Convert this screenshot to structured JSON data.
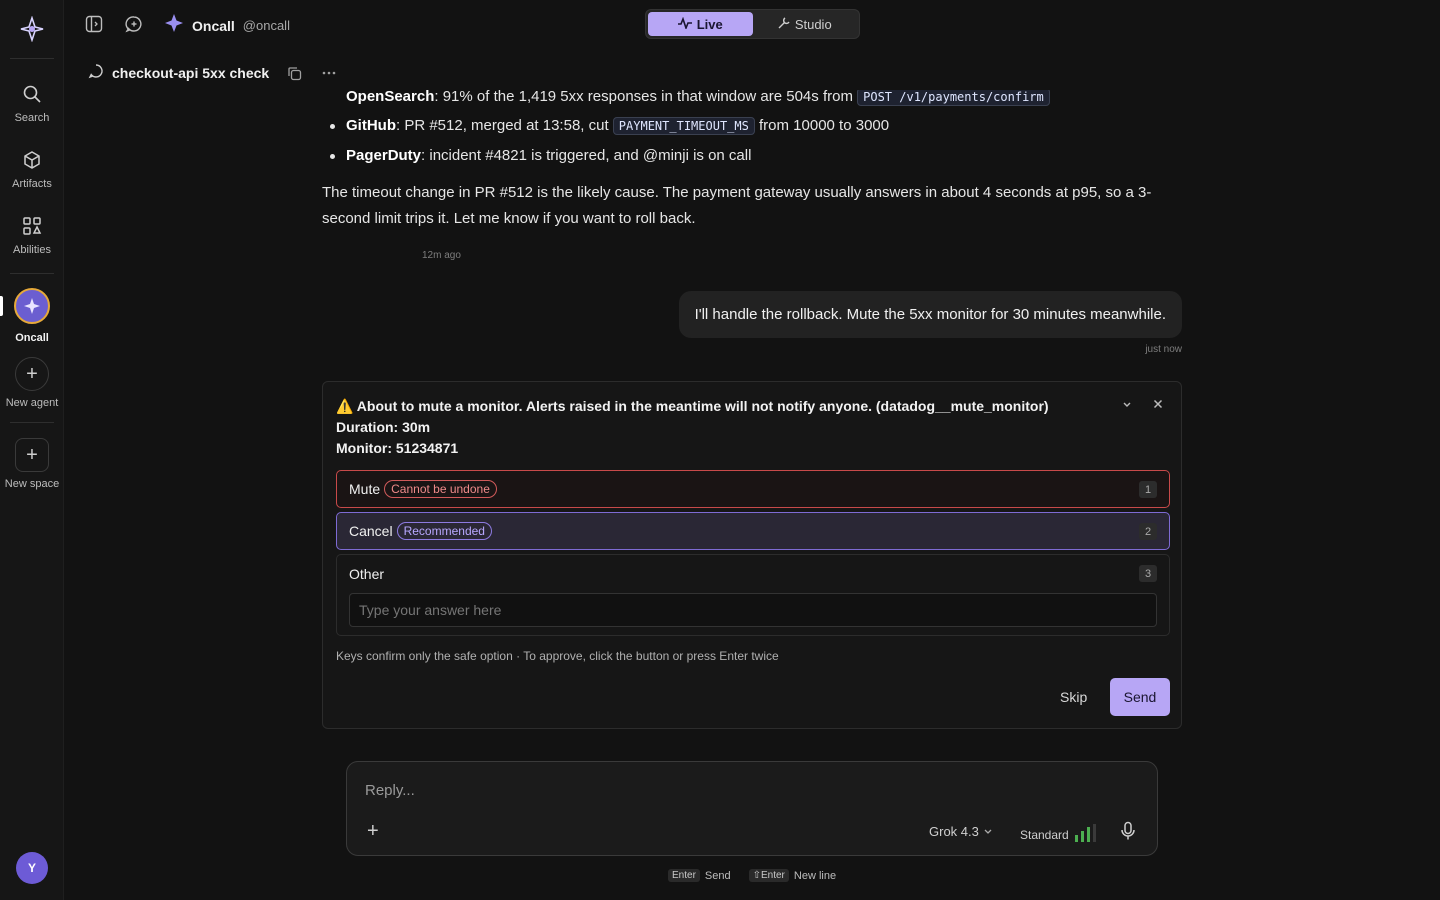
{
  "rail": {
    "items": [
      {
        "label": "Search",
        "icon": "search-icon"
      },
      {
        "label": "Artifacts",
        "icon": "cube-icon"
      },
      {
        "label": "Abilities",
        "icon": "grid-icon"
      },
      {
        "label": "Oncall",
        "icon": "agent-avatar"
      },
      {
        "label": "New agent",
        "icon": "plus-icon"
      },
      {
        "label": "New space",
        "icon": "plus-icon"
      }
    ],
    "user_initial": "Y"
  },
  "header": {
    "agent_name": "Oncall",
    "agent_handle": "@oncall",
    "modes": [
      {
        "label": "Live",
        "active": true
      },
      {
        "label": "Studio",
        "active": false
      }
    ]
  },
  "thread": {
    "title": "checkout-api 5xx check"
  },
  "messages": {
    "bullet_partial": {
      "source": "OpenSearch",
      "text": ": 91% of the 1,419 5xx responses in that window are 504s from ",
      "code": "POST /v1/payments/confirm"
    },
    "bullet_github": {
      "source": "GitHub",
      "text_a": ": PR #512, merged at 13:58, cut ",
      "code": "PAYMENT_TIMEOUT_MS",
      "text_b": " from 10000 to 3000"
    },
    "bullet_pagerduty": {
      "source": "PagerDuty",
      "text": ": incident #4821 is triggered, and @minji is on call"
    },
    "assistant_paragraph": "The timeout change in PR #512 is the likely cause. The payment gateway usually answers in about 4 seconds at p95, so a 3-second limit trips it. Let me know if you want to roll back.",
    "assistant_time": "12m ago",
    "user_message": "I'll handle the rollback. Mute the 5xx monitor for 30 minutes meanwhile.",
    "user_time": "just now"
  },
  "approval": {
    "warning": "⚠️ About to mute a monitor. Alerts raised in the meantime will not notify anyone. (datadog__mute_monitor)",
    "duration": "Duration: 30m",
    "monitor": "Monitor: 51234871",
    "options": [
      {
        "label": "Mute",
        "badge": "Cannot be undone",
        "key": "1"
      },
      {
        "label": "Cancel",
        "badge": "Recommended",
        "key": "2"
      },
      {
        "label": "Other",
        "key": "3"
      }
    ],
    "other_placeholder": "Type your answer here",
    "note": "Keys confirm only the safe option · To approve, click the button or press Enter twice",
    "skip_label": "Skip",
    "send_label": "Send"
  },
  "composer": {
    "placeholder": "Reply...",
    "model": "Grok 4.3",
    "mode": "Standard"
  },
  "hints": {
    "send_key": "Enter",
    "send_label": "Send",
    "newline_key": "⇧Enter",
    "newline_label": "New line"
  },
  "colors": {
    "accent": "#b7a6f5",
    "danger": "#c84a4a",
    "agent_ring": "#e6a93a",
    "signal": "#4caf50"
  }
}
